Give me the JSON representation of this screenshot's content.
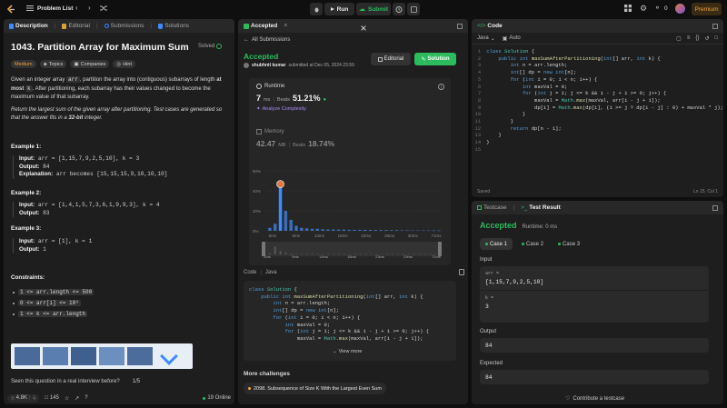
{
  "topbar": {
    "problem_list": "Problem List",
    "run": "Run",
    "submit": "Submit",
    "streak": "0",
    "premium": "Premium"
  },
  "left": {
    "tabs": [
      "Description",
      "Editorial",
      "Submissions",
      "Solutions"
    ],
    "title": "1043. Partition Array for Maximum Sum",
    "solved": "Solved",
    "chips": [
      "Medium",
      "Topics",
      "Companies",
      "Hint"
    ],
    "desc1_a": "Given an integer array ",
    "desc1_code": "arr",
    "desc1_b": ", partition the array into (contiguous) subarrays of length ",
    "desc1_bold": "at most",
    "desc1_code2": "k",
    "desc1_c": ". After partitioning, each subarray has their values changed to become the maximum value of that subarray.",
    "desc2_a": "Return the largest sum of the given array after partitioning. Test cases are generated so that the answer fits in a ",
    "desc2_bold": "32-bit",
    "desc2_c": " integer.",
    "examples": [
      {
        "title": "Example 1:",
        "input": "arr = [1,15,7,9,2,5,10], k = 3",
        "output": "84",
        "explanation": "arr becomes [15,15,15,9,10,10,10]"
      },
      {
        "title": "Example 2:",
        "input": "arr = [1,4,1,5,7,3,6,1,9,9,3], k = 4",
        "output": "83"
      },
      {
        "title": "Example 3:",
        "input": "arr = [1], k = 1",
        "output": "1"
      }
    ],
    "labels": {
      "input": "Input:",
      "output": "Output:",
      "explanation": "Explanation:"
    },
    "constraints_title": "Constraints:",
    "constraints": [
      "1 <= arr.length <= 500",
      "0 <= arr[i] <= 10⁹",
      "1 <= k <= arr.length"
    ],
    "seen": "Seen this question in a real interview before?",
    "seen_count": "1/5",
    "likes": "4.8K",
    "comments": "145",
    "online": "19 Online"
  },
  "middle": {
    "tab": "Accepted",
    "all_submissions": "All Submissions",
    "status": "Accepted",
    "author": "shubhnit kumar",
    "submitted": "submitted at Dec 05, 2024 23:59",
    "editorial": "Editorial",
    "solution": "Solution",
    "runtime_label": "Runtime",
    "runtime_value": "7",
    "runtime_unit": "ms",
    "beats_label": "Beats",
    "beats_value": "51.21%",
    "analyze": "Analyze Complexity",
    "memory_label": "Memory",
    "memory_value": "42.47",
    "memory_unit": "MB",
    "memory_beats_label": "Beats",
    "memory_beats": "18.74%",
    "code_tab": "Code",
    "code_lang": "Java",
    "view_more": "View more",
    "more_challenges": "More challenges",
    "challenge": "2098. Subsequence of Size K With the Largest Even Sum"
  },
  "chart_data": {
    "type": "bar",
    "title": "",
    "xlabel": "",
    "ylabel": "",
    "y_ticks": [
      "60%",
      "40%",
      "20%",
      "0%"
    ],
    "ylim": [
      0,
      60
    ],
    "x_ticks": [
      "5ms",
      "9ms",
      "14ms",
      "18ms",
      "22ms",
      "26ms",
      "30ms",
      "71ms"
    ],
    "values": [
      3,
      7,
      44,
      20,
      11,
      5,
      3,
      2.5,
      2,
      2,
      1.6,
      1.4,
      1.4,
      1.2,
      1.2,
      1,
      1,
      1,
      1,
      0.9,
      0.8,
      0.8,
      0.8,
      0.7,
      0.7,
      0.6,
      0.6,
      0.5,
      0.5,
      0.5,
      0.5,
      0.4,
      0.4
    ],
    "highlight_index": 2,
    "highlight_color": "#3c8cff",
    "bar_color": "#3a6fb8",
    "grid": true,
    "mini_ticks": [
      "3ms",
      "9ms",
      "14ms",
      "18ms",
      "23ms",
      "29ms",
      "71ms"
    ]
  },
  "code_short": [
    "class Solution {",
    "    public int maxSumAfterPartitioning(int[] arr, int k) {",
    "        int n = arr.length;",
    "        int[] dp = new int[n];",
    "        for (int i = 0; i < n; i++) {",
    "            int maxVal = 0;",
    "            for (int j = 1; j <= k && i - j + 1 >= 0; j++) {",
    "                maxVal = Math.max(maxVal, arr[i - j + 1]);"
  ],
  "editor": {
    "tab": "Code",
    "lang": "Java",
    "auto": "Auto",
    "saved": "Saved",
    "position": "Ln 15, Col 1",
    "line_numbers": [
      "1",
      "2",
      "3",
      "4",
      "5",
      "6",
      "7",
      "8",
      "9",
      "10",
      "11",
      "12",
      "13",
      "14",
      "15"
    ],
    "lines": [
      "class Solution {",
      "    public int maxSumAfterPartitioning(int[] arr, int k) {",
      "        int n = arr.length;",
      "        int[] dp = new int[n];",
      "        for (int i = 0; i < n; i++) {",
      "            int maxVal = 0;",
      "            for (int j = 1; j <= k && i - j + 1 >= 0; j++) {",
      "                maxVal = Math.max(maxVal, arr[i - j + 1]);",
      "                dp[i] = Math.max(dp[i], (i >= j ? dp[i - j] : 0) + maxVal * j);",
      "            }",
      "        }",
      "        return dp[n - 1];",
      "    }",
      "}",
      ""
    ]
  },
  "testpanel": {
    "tab1": "Testcase",
    "tab2": "Test Result",
    "status": "Accepted",
    "runtime": "Runtime: 0 ms",
    "cases": [
      "Case 1",
      "Case 2",
      "Case 3"
    ],
    "input_label": "Input",
    "arr_label": "arr =",
    "arr_value": "[1,15,7,9,2,5,10]",
    "k_label": "k =",
    "k_value": "3",
    "output_label": "Output",
    "output_value": "84",
    "expected_label": "Expected",
    "expected_value": "84",
    "contribute": "Contribute a testcase"
  }
}
